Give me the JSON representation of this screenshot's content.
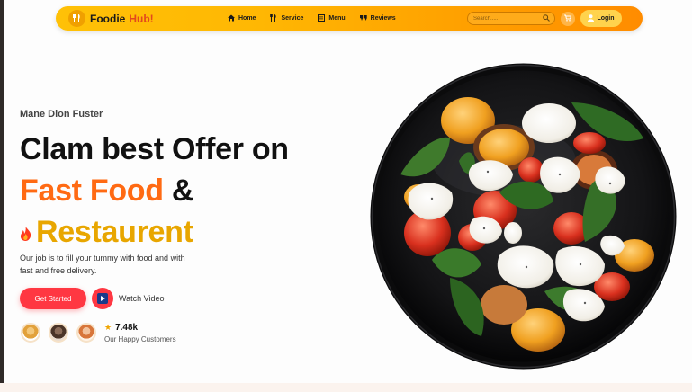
{
  "navbar": {
    "brand_name": "Foodie",
    "brand_accent": "Hub!",
    "items": [
      {
        "label": "Home",
        "icon": "home-icon"
      },
      {
        "label": "Service",
        "icon": "utensils-icon"
      },
      {
        "label": "Menu",
        "icon": "menu-icon"
      },
      {
        "label": "Reviews",
        "icon": "quote-icon"
      }
    ],
    "search_placeholder": "Search.....",
    "login_label": "Login"
  },
  "hero": {
    "subtitle": "Mane Dion Fuster",
    "title_line1": "Clam best Offer on",
    "title_line2_highlight": "Fast Food",
    "title_line2_rest": "&",
    "title_line3": "Restaurent",
    "description": "Our job is to fill your tummy with food and with fast and free delivery.",
    "cta_label": "Get Started",
    "watch_label": "Watch Video",
    "rating_value": "7.48k",
    "rating_label": "Our Happy Customers"
  },
  "colors": {
    "nav_gradient_start": "#ffc107",
    "nav_gradient_end": "#ff8c00",
    "accent_red": "#ff3742",
    "accent_orange": "#ff6a13",
    "accent_gold": "#e8a600"
  }
}
